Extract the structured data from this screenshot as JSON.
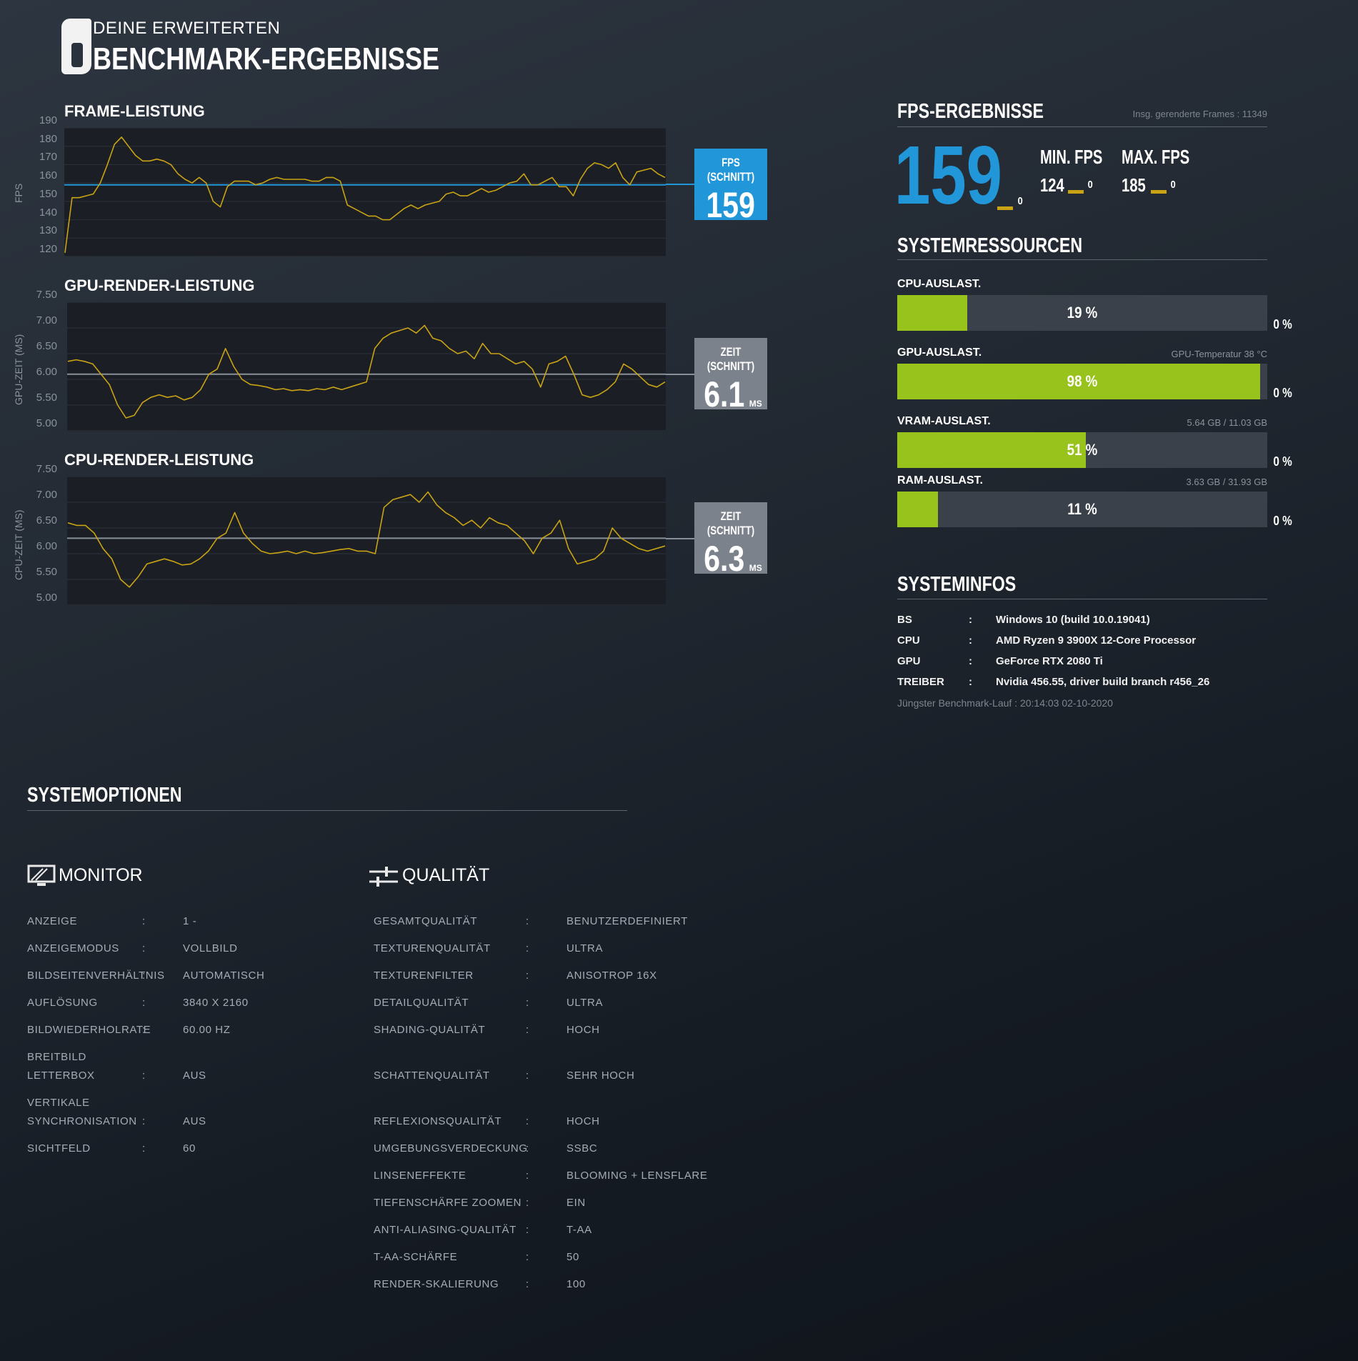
{
  "header": {
    "logo_text": "6",
    "subtitle": "DEINE ERWEITERTEN",
    "title": "BENCHMARK-ERGEBNISSE"
  },
  "frame_chart": {
    "title": "FRAME-LEISTUNG",
    "ylabel": "FPS",
    "ticks": [
      "190",
      "180",
      "170",
      "160",
      "150",
      "140",
      "130",
      "120"
    ],
    "avg_label": "FPS (SCHNITT)",
    "avg_value": "159",
    "avg_color": "#2196d8",
    "line_color": "#c9a314"
  },
  "gpu_chart": {
    "title": "GPU-RENDER-LEISTUNG",
    "ylabel": "GPU-ZEIT (MS)",
    "ticks": [
      "7.50",
      "7.00",
      "6.50",
      "6.00",
      "5.50",
      "5.00"
    ],
    "avg_label": "ZEIT (SCHNITT)",
    "avg_value": "6.1",
    "avg_unit": "MS"
  },
  "cpu_chart": {
    "title": "CPU-RENDER-LEISTUNG",
    "ylabel": "CPU-ZEIT (MS)",
    "ticks": [
      "7.50",
      "7.00",
      "6.50",
      "6.00",
      "5.50",
      "5.00"
    ],
    "avg_label": "ZEIT (SCHNITT)",
    "avg_value": "6.3",
    "avg_unit": "MS"
  },
  "chart_data": [
    {
      "type": "line",
      "title": "FRAME-LEISTUNG",
      "ylabel": "FPS",
      "ylim": [
        120,
        190
      ],
      "series": [
        {
          "values": [
            122,
            152,
            152,
            153,
            154,
            160,
            170,
            181,
            185,
            180,
            175,
            172,
            172,
            173,
            172,
            170,
            165,
            162,
            160,
            163,
            160,
            150,
            147,
            158,
            161,
            161,
            161,
            159,
            160,
            162,
            163,
            162,
            162,
            162,
            162,
            161,
            161,
            163,
            163,
            161,
            148,
            146,
            144,
            142,
            142,
            140,
            140,
            143,
            146,
            148,
            146,
            148,
            149,
            150,
            154,
            155,
            153,
            153,
            155,
            157,
            155,
            156,
            158,
            160,
            161,
            165,
            159,
            159,
            161,
            163,
            158,
            158,
            153,
            162,
            168,
            171,
            170,
            168,
            171,
            163,
            159,
            166,
            167,
            168,
            165,
            163
          ]
        }
      ],
      "avg": 159
    },
    {
      "type": "line",
      "title": "GPU-RENDER-LEISTUNG",
      "ylabel": "GPU-ZEIT (MS)",
      "ylim": [
        5.0,
        7.5
      ],
      "series": [
        {
          "values": [
            6.35,
            6.38,
            6.35,
            6.3,
            6.1,
            5.9,
            5.5,
            5.25,
            5.3,
            5.55,
            5.65,
            5.7,
            5.65,
            5.68,
            5.6,
            5.65,
            5.8,
            6.1,
            6.2,
            6.6,
            6.25,
            6.0,
            5.9,
            5.88,
            5.85,
            5.8,
            5.82,
            5.78,
            5.8,
            5.78,
            5.82,
            5.8,
            5.85,
            5.8,
            5.85,
            5.9,
            5.95,
            6.6,
            6.8,
            6.9,
            6.95,
            7.0,
            6.9,
            7.05,
            6.8,
            6.75,
            6.6,
            6.5,
            6.55,
            6.4,
            6.7,
            6.5,
            6.5,
            6.4,
            6.3,
            6.35,
            6.2,
            5.85,
            6.3,
            6.35,
            6.45,
            6.1,
            5.7,
            5.65,
            5.7,
            5.8,
            5.95,
            6.3,
            6.2,
            6.05,
            5.9,
            5.85,
            5.95
          ]
        }
      ],
      "avg": 6.1
    },
    {
      "type": "line",
      "title": "CPU-RENDER-LEISTUNG",
      "ylabel": "CPU-ZEIT (MS)",
      "ylim": [
        5.0,
        7.5
      ],
      "series": [
        {
          "values": [
            6.6,
            6.55,
            6.55,
            6.4,
            6.1,
            5.9,
            5.5,
            5.35,
            5.55,
            5.8,
            5.85,
            5.9,
            5.85,
            5.78,
            5.8,
            5.9,
            6.05,
            6.3,
            6.4,
            6.8,
            6.4,
            6.2,
            6.05,
            6.0,
            6.02,
            6.05,
            6.0,
            6.05,
            6.0,
            6.02,
            6.05,
            6.08,
            6.1,
            6.05,
            6.05,
            6.0,
            6.9,
            7.05,
            7.1,
            7.15,
            7.0,
            7.2,
            6.95,
            6.8,
            6.7,
            6.55,
            6.65,
            6.5,
            6.7,
            6.6,
            6.55,
            6.4,
            6.25,
            6.0,
            6.3,
            6.4,
            6.65,
            6.1,
            5.8,
            5.85,
            5.9,
            6.05,
            6.5,
            6.3,
            6.2,
            6.1,
            6.05,
            6.1,
            6.15
          ]
        }
      ],
      "avg": 6.3
    }
  ],
  "fps": {
    "title": "FPS-ERGEBNISSE",
    "total_frames_label": "Insg. gerenderte Frames : 11349",
    "avg": "159",
    "avg_zero": "0",
    "min_label": "MIN. FPS",
    "min_value": "124",
    "min_zero": "0",
    "max_label": "MAX. FPS",
    "max_value": "185",
    "max_zero": "0"
  },
  "resources": {
    "title": "SYSTEMRESSOURCEN",
    "items": [
      {
        "label": "CPU-AUSLAST.",
        "value": "19 %",
        "fraction": 0.19,
        "right_info": "",
        "zero": "0 %"
      },
      {
        "label": "GPU-AUSLAST.",
        "value": "98 %",
        "fraction": 0.98,
        "right_info": "GPU-Temperatur 38 °C",
        "zero": "0 %"
      },
      {
        "label": "VRAM-AUSLAST.",
        "value": "51 %",
        "fraction": 0.51,
        "right_info": "5.64 GB / 11.03 GB",
        "zero": "0 %"
      },
      {
        "label": "RAM-AUSLAST.",
        "value": "11 %",
        "fraction": 0.11,
        "right_info": "3.63 GB / 31.93 GB",
        "zero": "0 %"
      }
    ]
  },
  "sysinfo": {
    "title": "SYSTEMINFOS",
    "rows": [
      {
        "key": "BS",
        "sep": ":",
        "value": "Windows 10 (build 10.0.19041)"
      },
      {
        "key": "CPU",
        "sep": ":",
        "value": "AMD Ryzen 9 3900X 12-Core Processor"
      },
      {
        "key": "GPU",
        "sep": ":",
        "value": "GeForce RTX 2080 Ti"
      },
      {
        "key": "TREIBER",
        "sep": ":",
        "value": "Nvidia 456.55, driver build branch r456_26"
      }
    ],
    "last_run": "Jüngster Benchmark-Lauf : 20:14:03 02-10-2020"
  },
  "options": {
    "title": "SYSTEMOPTIONEN",
    "monitor": {
      "title": "MONITOR",
      "rows": [
        {
          "key": "ANZEIGE",
          "key2": "",
          "sep": ":",
          "value": "1 -"
        },
        {
          "key": "ANZEIGEMODUS",
          "key2": "",
          "sep": ":",
          "value": "VOLLBILD"
        },
        {
          "key": "BILDSEITENVERHÄLTNIS",
          "key2": "",
          "sep": ":",
          "value": "AUTOMATISCH"
        },
        {
          "key": "AUFLÖSUNG",
          "key2": "",
          "sep": ":",
          "value": "3840 X 2160"
        },
        {
          "key": "BILDWIEDERHOLRATE",
          "key2": "",
          "sep": ":",
          "value": "60.00 HZ"
        },
        {
          "key": "BREITBILD",
          "key2": "LETTERBOX",
          "sep": ":",
          "value": "AUS"
        },
        {
          "key": "VERTIKALE",
          "key2": "SYNCHRONISATION",
          "sep": ":",
          "value": "AUS"
        },
        {
          "key": "SICHTFELD",
          "key2": "",
          "sep": ":",
          "value": "60"
        }
      ]
    },
    "quality": {
      "title": "QUALITÄT",
      "rows": [
        {
          "key": "GESAMTQUALITÄT",
          "sep": ":",
          "value": "BENUTZERDEFINIERT"
        },
        {
          "key": "TEXTURENQUALITÄT",
          "sep": ":",
          "value": "ULTRA"
        },
        {
          "key": "TEXTURENFILTER",
          "sep": ":",
          "value": "ANISOTROP 16X"
        },
        {
          "key": "DETAILQUALITÄT",
          "sep": ":",
          "value": "ULTRA"
        },
        {
          "key": "SHADING-QUALITÄT",
          "sep": ":",
          "value": "HOCH"
        },
        {
          "key": "SCHATTENQUALITÄT",
          "sep": ":",
          "value": "SEHR HOCH"
        },
        {
          "key": "REFLEXIONSQUALITÄT",
          "sep": ":",
          "value": "HOCH"
        },
        {
          "key": "UMGEBUNGSVERDECKUNG",
          "sep": ":",
          "value": "SSBC"
        },
        {
          "key": "LINSENEFFEKTE",
          "sep": ":",
          "value": "BLOOMING + LENSFLARE"
        },
        {
          "key": "TIEFENSCHÄRFE ZOOMEN",
          "sep": ":",
          "value": "EIN"
        },
        {
          "key": "ANTI-ALIASING-QUALITÄT",
          "sep": ":",
          "value": "T-AA"
        },
        {
          "key": "T-AA-SCHÄRFE",
          "sep": ":",
          "value": "50"
        },
        {
          "key": "RENDER-SKALIERUNG",
          "sep": ":",
          "value": "100"
        }
      ]
    }
  },
  "icons": {
    "logo": "rainbow-six-logo",
    "monitor": "monitor-icon",
    "quality": "sliders-icon"
  }
}
